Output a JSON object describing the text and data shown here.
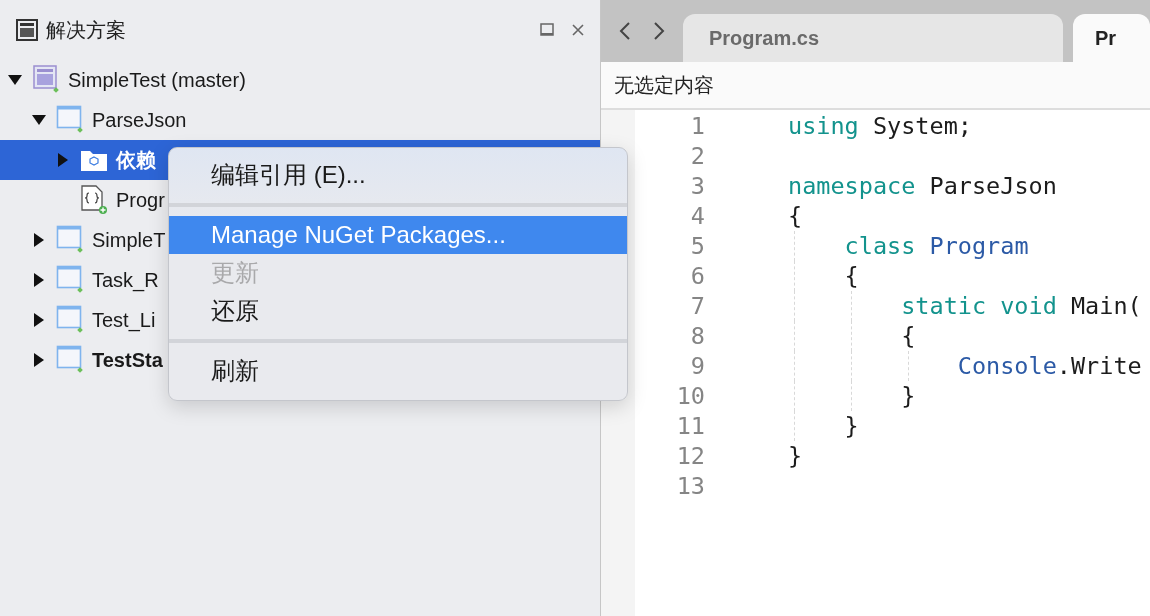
{
  "solution_panel": {
    "title": "解决方案",
    "tree": [
      {
        "label": "SimpleTest (master)",
        "kind": "solution",
        "expanded": true,
        "selected": false,
        "startup": false,
        "children": [
          {
            "label": "ParseJson",
            "kind": "project",
            "expanded": true,
            "selected": false,
            "startup": false,
            "children": [
              {
                "label": "依赖",
                "kind": "folder",
                "expanded": false,
                "selected": true,
                "startup": false
              },
              {
                "label": "Progr",
                "kind": "file",
                "selected": false,
                "startup": false
              }
            ]
          },
          {
            "label": "SimpleT",
            "kind": "project",
            "expanded": false,
            "selected": false,
            "startup": false
          },
          {
            "label": "Task_R",
            "kind": "project",
            "expanded": false,
            "selected": false,
            "startup": false
          },
          {
            "label": "Test_Li",
            "kind": "project",
            "expanded": false,
            "selected": false,
            "startup": false
          },
          {
            "label": "TestSta",
            "kind": "project",
            "expanded": false,
            "selected": false,
            "startup": true
          }
        ]
      }
    ]
  },
  "context_menu": {
    "items": [
      {
        "kind": "item",
        "label": "编辑引用 (E)...",
        "selected": false,
        "disabled": false
      },
      {
        "kind": "separator"
      },
      {
        "kind": "item",
        "label": "Manage NuGet Packages...",
        "selected": true,
        "disabled": false
      },
      {
        "kind": "item",
        "label": "更新",
        "selected": false,
        "disabled": true
      },
      {
        "kind": "item",
        "label": "还原",
        "selected": false,
        "disabled": false
      },
      {
        "kind": "separator"
      },
      {
        "kind": "item",
        "label": "刷新",
        "selected": false,
        "disabled": false
      }
    ]
  },
  "editor": {
    "tabs": [
      {
        "label": "Program.cs",
        "selected": false
      },
      {
        "label": "Pr",
        "selected": true
      }
    ],
    "breadcrumb": "无选定内容",
    "lines": [
      {
        "number": "1",
        "tokens": [
          {
            "kind": "keyword",
            "text": "using"
          },
          {
            "kind": "plain",
            "text": " System;"
          }
        ]
      },
      {
        "number": "2"
      },
      {
        "number": "3",
        "tokens": [
          {
            "kind": "keyword",
            "text": "namespace"
          },
          {
            "kind": "plain",
            "text": " ParseJson"
          }
        ]
      },
      {
        "number": "4",
        "tokens": [
          {
            "kind": "plain",
            "text": "{"
          }
        ]
      },
      {
        "number": "5",
        "tokens": [
          {
            "kind": "keyword",
            "text": "    class"
          },
          {
            "kind": "type",
            "text": " Program"
          }
        ]
      },
      {
        "number": "6",
        "tokens": [
          {
            "kind": "plain",
            "text": "    {"
          }
        ]
      },
      {
        "number": "7",
        "tokens": [
          {
            "kind": "keyword",
            "text": "        static void"
          },
          {
            "kind": "plain",
            "text": " Main("
          }
        ]
      },
      {
        "number": "8",
        "tokens": [
          {
            "kind": "plain",
            "text": "        {"
          }
        ]
      },
      {
        "number": "9",
        "tokens": [
          {
            "kind": "type",
            "text": "            Console"
          },
          {
            "kind": "plain",
            "text": ".Write"
          }
        ]
      },
      {
        "number": "10",
        "tokens": [
          {
            "kind": "plain",
            "text": "        }"
          }
        ]
      },
      {
        "number": "11",
        "tokens": [
          {
            "kind": "plain",
            "text": "    }"
          }
        ]
      },
      {
        "number": "12",
        "tokens": [
          {
            "kind": "plain",
            "text": "}"
          }
        ]
      },
      {
        "number": "13"
      }
    ]
  }
}
